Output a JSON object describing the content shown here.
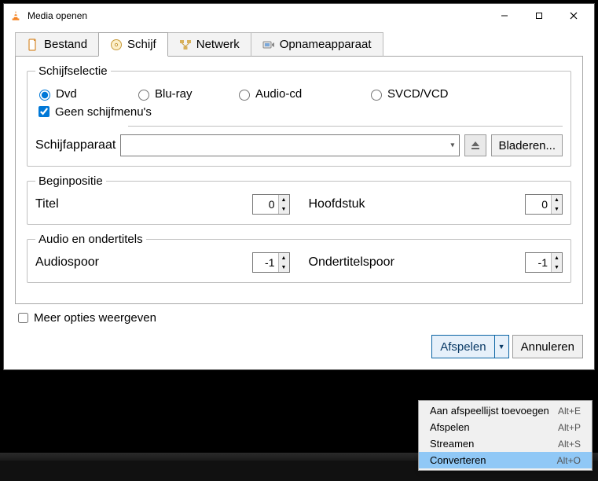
{
  "window": {
    "title": "Media openen"
  },
  "tabs": {
    "file": {
      "label": "Bestand"
    },
    "disc": {
      "label": "Schijf"
    },
    "network": {
      "label": "Netwerk"
    },
    "capture": {
      "label": "Opnameapparaat"
    }
  },
  "discSelection": {
    "legend": "Schijfselectie",
    "dvd": {
      "label": "Dvd",
      "checked": true
    },
    "bluray": {
      "label": "Blu-ray"
    },
    "audiocd": {
      "label": "Audio-cd"
    },
    "svcd": {
      "label": "SVCD/VCD"
    },
    "nomenus": {
      "label": "Geen schijfmenu's",
      "checked": true
    },
    "deviceLabel": "Schijfapparaat",
    "deviceValue": "",
    "browse": "Bladeren..."
  },
  "startPosition": {
    "legend": "Beginpositie",
    "titleLabel": "Titel",
    "titleValue": "0",
    "chapterLabel": "Hoofdstuk",
    "chapterValue": "0"
  },
  "audioSubs": {
    "legend": "Audio en ondertitels",
    "audioTrackLabel": "Audiospoor",
    "audioTrackValue": "-1",
    "subTrackLabel": "Ondertitelspoor",
    "subTrackValue": "-1"
  },
  "moreOptions": {
    "label": "Meer opties weergeven",
    "checked": false
  },
  "footer": {
    "play": "Afspelen",
    "cancel": "Annuleren"
  },
  "dropdownMenu": {
    "items": [
      {
        "label": "Aan afspeellijst toevoegen",
        "shortcut": "Alt+E",
        "selected": false
      },
      {
        "label": "Afspelen",
        "shortcut": "Alt+P",
        "selected": false
      },
      {
        "label": "Streamen",
        "shortcut": "Alt+S",
        "selected": false
      },
      {
        "label": "Converteren",
        "shortcut": "Alt+O",
        "selected": true
      }
    ]
  }
}
